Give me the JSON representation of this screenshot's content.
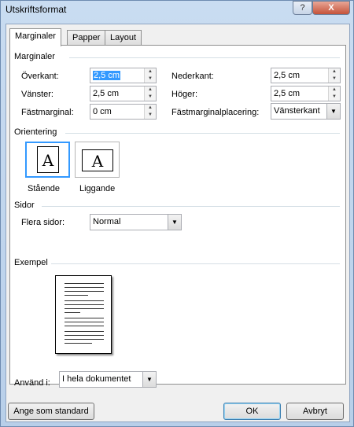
{
  "window": {
    "title": "Utskriftsformat",
    "help_label": "?",
    "close_label": "X"
  },
  "tabs": [
    "Marginaler",
    "Papper",
    "Layout"
  ],
  "margins": {
    "section_title": "Marginaler",
    "top": {
      "label": "Överkant:",
      "value": "2,5 cm"
    },
    "bottom": {
      "label": "Nederkant:",
      "value": "2,5 cm"
    },
    "left": {
      "label": "Vänster:",
      "value": "2,5 cm"
    },
    "right": {
      "label": "Höger:",
      "value": "2,5 cm"
    },
    "gutter": {
      "label": "Fästmarginal:",
      "value": "0 cm"
    },
    "gutter_position": {
      "label": "Fästmarginalplacering:",
      "value": "Vänsterkant"
    }
  },
  "orientation": {
    "section_title": "Orientering",
    "portrait_label": "Stående",
    "landscape_label": "Liggande",
    "icon_letter": "A",
    "selected": "portrait"
  },
  "pages": {
    "section_title": "Sidor",
    "multiple_label": "Flera sidor:",
    "multiple_value": "Normal"
  },
  "preview": {
    "section_title": "Exempel"
  },
  "apply": {
    "label": "Använd i:",
    "value": "I hela dokumentet"
  },
  "buttons": {
    "default": "Ange som standard",
    "ok": "OK",
    "cancel": "Avbryt"
  },
  "colors": {
    "selection": "#3399ff",
    "titlebar": "#c9dcf1",
    "close": "#c5533a"
  }
}
